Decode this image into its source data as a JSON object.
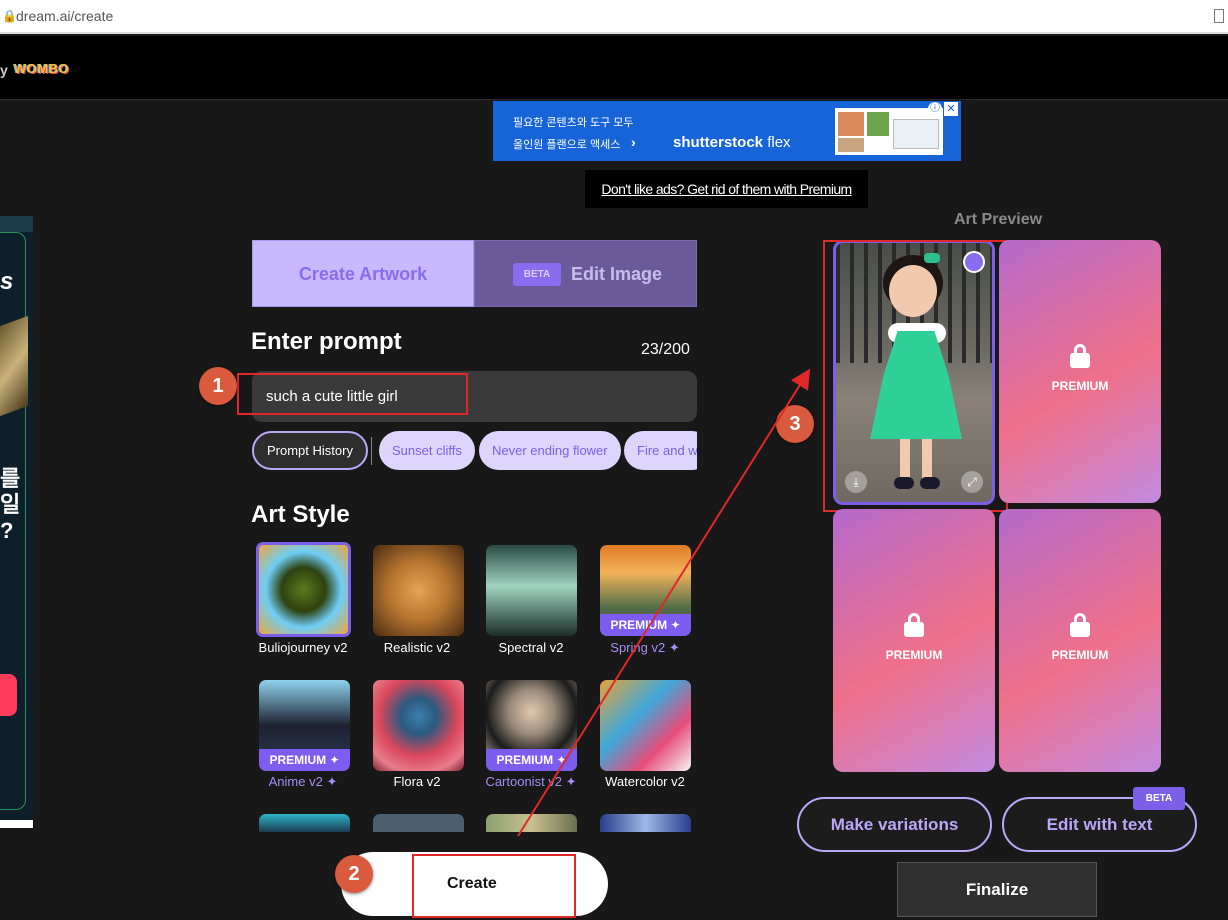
{
  "browser": {
    "url": "dream.ai/create"
  },
  "nav": {
    "by": "y",
    "brand": "WOMBO"
  },
  "top_ad": {
    "line1": "필요한 콘텐츠와 도구 모두",
    "line2": "올인원 플랜으로 액세스",
    "arrow": "›",
    "brand_bold": "shutterstock",
    "brand_light": " flex",
    "info_icon": "ⓘ",
    "close_icon": "✕"
  },
  "ad_notice": "Don't like ads? Get rid of them with Premium",
  "left_ad": {
    "big": "s",
    "kr": "를\n일\n?"
  },
  "tabs": {
    "create": "Create Artwork",
    "edit_beta": "BETA",
    "edit": "Edit Image"
  },
  "prompt": {
    "title": "Enter prompt",
    "count": "23/200",
    "value": "such a cute little girl"
  },
  "chips": {
    "history": "Prompt History",
    "suggestions": [
      "Sunset cliffs",
      "Never ending flower",
      "Fire and w"
    ]
  },
  "art_style": {
    "title": "Art Style",
    "premium_tag": "PREMIUM ✦",
    "tiles": [
      {
        "label": "Buliojourney v2"
      },
      {
        "label": "Realistic v2"
      },
      {
        "label": "Spectral v2"
      },
      {
        "label": "Spring v2 ✦"
      },
      {
        "label": "Anime v2 ✦"
      },
      {
        "label": "Flora v2"
      },
      {
        "label": "Cartoonist v2 ✦"
      },
      {
        "label": "Watercolor v2"
      }
    ]
  },
  "create_button": "Create",
  "annotations": [
    "1",
    "2",
    "3"
  ],
  "preview": {
    "title": "Art Preview",
    "premium_label": "PREMIUM",
    "download_icon": "⤓",
    "expand_icon": "⤢"
  },
  "actions": {
    "variations": "Make variations",
    "edit_text": "Edit with text",
    "edit_text_beta": "BETA",
    "finalize": "Finalize"
  },
  "colors": {
    "accent": "#7b5fe8",
    "annotation_red": "#e02828",
    "badge": "#d95a3c",
    "background": "#181818"
  }
}
